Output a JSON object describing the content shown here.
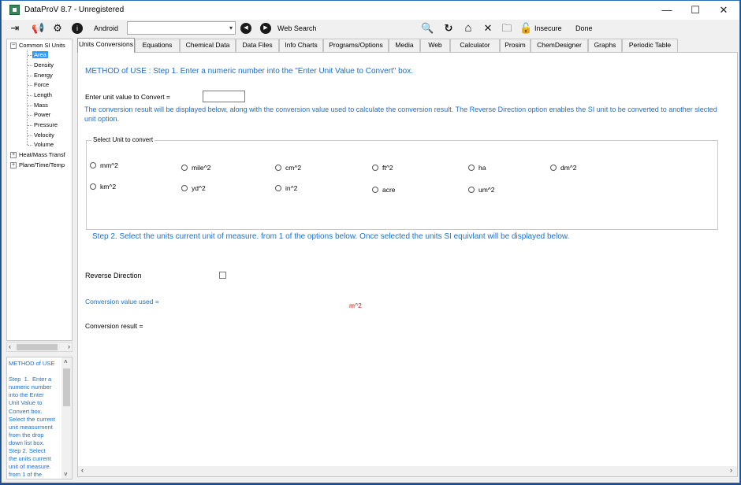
{
  "window": {
    "title": "DataProV 8.7 - Unregistered",
    "minimize_glyph": "—",
    "maximize_glyph": "☐",
    "close_glyph": "✕"
  },
  "toolbar": {
    "android_label": "Android",
    "url_value": "",
    "web_search_label": "Web Search",
    "insecure_label": "Insecure",
    "done_label": "Done",
    "icons": {
      "exit": "⇥",
      "announce": "📢",
      "settings": "⚙",
      "info": "i",
      "back": "◀",
      "forward": "▶",
      "search": "🔍",
      "refresh": "↻",
      "home": "⌂",
      "stop": "✕",
      "folder": "🗀",
      "lock": "🔓"
    }
  },
  "tree": {
    "root": "Common SI Units",
    "children": [
      "Area",
      "Density",
      "Energy",
      "Force",
      "Length",
      "Mass",
      "Power",
      "Pressure",
      "Velocity",
      "Volume"
    ],
    "selected": "Area",
    "others": [
      "Heat/Mass Transf",
      "Plane/Time/Temp"
    ]
  },
  "help": {
    "text": "METHOD of USE\n\nStep  1.  Enter a\nnumeric number\ninto the Enter\nUnit Value to\nConvert box.\nSelect the current\nunit measurment\nfrom the drop\ndown list box.\nStep 2. Select\nthe units current\nunit of measure.\nfrom 1 of the"
  },
  "tabs": [
    {
      "label": "Units Conversions",
      "active": true
    },
    {
      "label": "Equations"
    },
    {
      "label": "Chemical Data"
    },
    {
      "label": "Data Files"
    },
    {
      "label": "Info Charts"
    },
    {
      "label": "Programs/Options"
    },
    {
      "label": "Media"
    },
    {
      "label": "Web"
    },
    {
      "label": "Calculator"
    },
    {
      "label": "Prosim"
    },
    {
      "label": "ChemDesigner"
    },
    {
      "label": "Graphs"
    },
    {
      "label": "Periodic Table"
    }
  ],
  "content": {
    "method_heading": "METHOD of USE : Step  1.  Enter a numeric number into the \"Enter Unit Value to Convert\" box.",
    "enter_label": "Enter unit value to Convert =",
    "enter_value": "",
    "conversion_note": "The conversion result will be displayed below, along with the conversion value used to calculate the conversion result. The Reverse Direction option enables the SI unit to be converted to another slected unit option.",
    "group_title": "Select Unit to convert",
    "units": [
      "mm^2",
      "mile^2",
      "cm^2",
      "ft^2",
      "ha",
      "dm^2",
      "km^2",
      "yd^2",
      "in^2",
      "acre",
      "um^2"
    ],
    "step2": "Step 2. Select the units current unit of measure. from 1 of the options below. Once selected the units SI equivlant will be displayed below.",
    "reverse_label": "Reverse Direction",
    "conv_value_label": "Conversion value used =",
    "si_unit": "m^2",
    "conv_result_label": "Conversion result ="
  }
}
